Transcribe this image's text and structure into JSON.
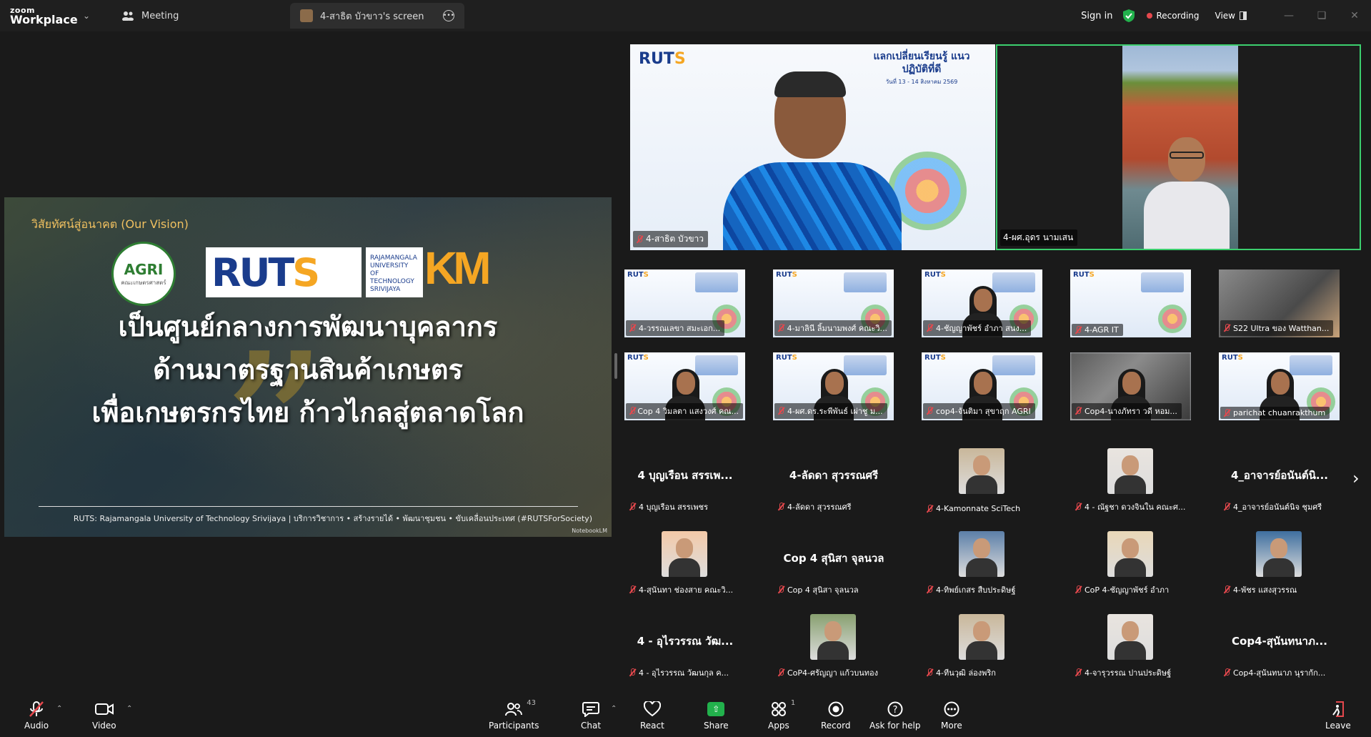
{
  "app": {
    "brand_top": "zoom",
    "brand_bottom": "Workplace",
    "tabs": [
      {
        "label": "Meeting"
      },
      {
        "label": "4-สาธิต บัวขาว's screen"
      }
    ],
    "sign_in": "Sign in",
    "recording": "Recording",
    "view": "View"
  },
  "shared_screen": {
    "vision_label": "วิสัยทัศน์สู่อนาคต (Our Vision)",
    "agri_logo_text": "AGRI",
    "agri_logo_sub": "คณะเกษตรศาสตร์",
    "ruts_logo": "RUT",
    "ruts_logo_s": "S",
    "ruts_sub": "RAJAMANGALA UNIVERSITY OF TECHNOLOGY SRIVIJAYA",
    "km_logo": "KM",
    "quote_mark": "”",
    "headline_1": "เป็นศูนย์กลางการพัฒนาบุคลากร",
    "headline_2": "ด้านมาตรฐานสินค้าเกษตร",
    "headline_3": "เพื่อเกษตรกรไทย ก้าวไกลสู่ตลาดโลก",
    "footer": "RUTS: Rajamangala University of Technology Srivijaya | บริการวิชาการ • สร้างรายได้ • พัฒนาชุมชน • ขับเคลื่อนประเทศ (#RUTSForSociety)",
    "watermark": "NotebookLM"
  },
  "spotlight": [
    {
      "name": "4-สาธิต บัวขาว",
      "slide_title": "แลกเปลี่ยนเรียนรู้ แนวปฏิบัติที่ดี",
      "slide_sub": "วันที่ 13 - 14 สิงหาคม 2569"
    },
    {
      "name": "4-ผศ.อุดร นามเสน"
    }
  ],
  "video_grid": [
    {
      "name": "4-วรรณเลขา สมะเอก..."
    },
    {
      "name": "4-มาลินี ลิ้มนามพงศ์ คณะวิ..."
    },
    {
      "name": "4-ชัญญาพัชร์ อำภา สนง..."
    },
    {
      "name": "4-AGR IT"
    },
    {
      "name": "S22 Ultra ของ Watthan..."
    },
    {
      "name": "Cop 4 วิมลตา แสงวงศ์ คณ..."
    },
    {
      "name": "4-ผศ.ดร.ระพีพันธ์ เผ่าชู ม..."
    },
    {
      "name": "cop4-จันติมา สุขาฤก AGRI"
    },
    {
      "name": "Cop4-นางภัทรา วดี หอม..."
    },
    {
      "name": "parichat chuanrakthum"
    }
  ],
  "name_tiles": [
    {
      "big": "4 บุญเรือน สรรเพ...",
      "name": "4 บุญเรือน สรรเพชร"
    },
    {
      "big": "4-ลัดดา สุวรรณศรี",
      "name": "4-ลัดดา สุวรรณศรี"
    },
    {
      "big": "",
      "name": "4-Kamonnate SciTech"
    },
    {
      "big": "",
      "name": "4 - ณัฐชา ดวงจินใน คณะศ..."
    },
    {
      "big": "4_อาจารย์อนันต์นิ...",
      "name": "4_อาจารย์อนันต์นิจ ชุมศรี"
    },
    {
      "big": "",
      "name": "4-สุนันทา ช่องสาย คณะวิ..."
    },
    {
      "big": "Cop 4 สุนิสา จุลนวล",
      "name": "Cop 4 สุนิสา จุลนวล"
    },
    {
      "big": "",
      "name": "4-ทิพย์เกสร สืบประดิษฐ์"
    },
    {
      "big": "",
      "name": "CoP 4-ชัญญาพัชร์ อำภา"
    },
    {
      "big": "",
      "name": "4-พัชร แสงสุวรรณ"
    },
    {
      "big": "4 - อุไรวรรณ วัฒ...",
      "name": "4 - อุไรวรรณ วัฒนกุล ค..."
    },
    {
      "big": "",
      "name": "CoP4-ศรัญญา แก้วบนทอง"
    },
    {
      "big": "",
      "name": "4-ทีนวุฒิ ล่องพริก"
    },
    {
      "big": "",
      "name": "4-จารุวรรณ ปานประดิษฐ์"
    },
    {
      "big": "Cop4-สุนันทนาภ...",
      "name": "Cop4-สุนันทนาภ นุรากัก..."
    }
  ],
  "toolbar": {
    "audio": "Audio",
    "video": "Video",
    "participants": "Participants",
    "participants_count": "43",
    "chat": "Chat",
    "react": "React",
    "share": "Share",
    "apps": "Apps",
    "apps_count": "1",
    "record": "Record",
    "help": "Ask for help",
    "more": "More",
    "leave": "Leave"
  },
  "colors": {
    "accent_green": "#3ccf6e",
    "mute_red": "#e5484d",
    "share_green": "#22b14c",
    "ruts_blue": "#1a3c8c",
    "ruts_orange": "#f5a623"
  }
}
